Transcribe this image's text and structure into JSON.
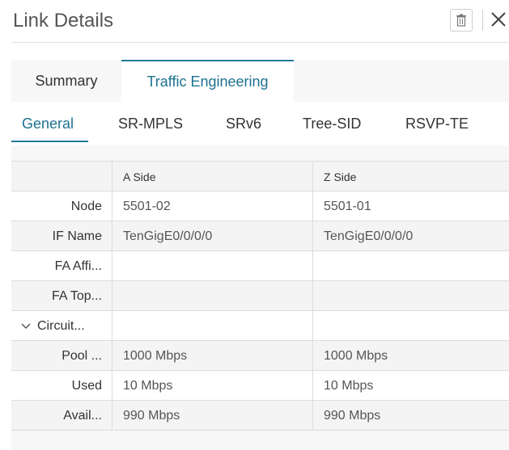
{
  "header": {
    "title": "Link Details"
  },
  "tabs": [
    {
      "label": "Summary",
      "active": false
    },
    {
      "label": "Traffic Engineering",
      "active": true
    }
  ],
  "subtabs": [
    "General",
    "SR-MPLS",
    "SRv6",
    "Tree-SID",
    "RSVP-TE"
  ],
  "table": {
    "columns": [
      "",
      "A Side",
      "Z Side"
    ],
    "rows": [
      {
        "label": "Node",
        "a": "5501-02",
        "z": "5501-01"
      },
      {
        "label": "IF Name",
        "a": "TenGigE0/0/0/0",
        "z": "TenGigE0/0/0/0"
      },
      {
        "label": "FA Affi...",
        "a": "",
        "z": ""
      },
      {
        "label": "FA Top...",
        "a": "",
        "z": ""
      },
      {
        "label": "Circuit...",
        "a": "",
        "z": ""
      },
      {
        "label": "Pool ...",
        "a": "1000 Mbps",
        "z": "1000 Mbps"
      },
      {
        "label": "Used",
        "a": "10 Mbps",
        "z": "10 Mbps"
      },
      {
        "label": "Avail...",
        "a": "990 Mbps",
        "z": "990 Mbps"
      }
    ]
  },
  "colors": {
    "accent": "#1d7290",
    "panel_bg": "#f7f7f7",
    "border": "#dcdcdc"
  },
  "icons": {
    "trash": "trash-icon",
    "close": "close-icon",
    "collapse": "chevron-down-icon"
  }
}
